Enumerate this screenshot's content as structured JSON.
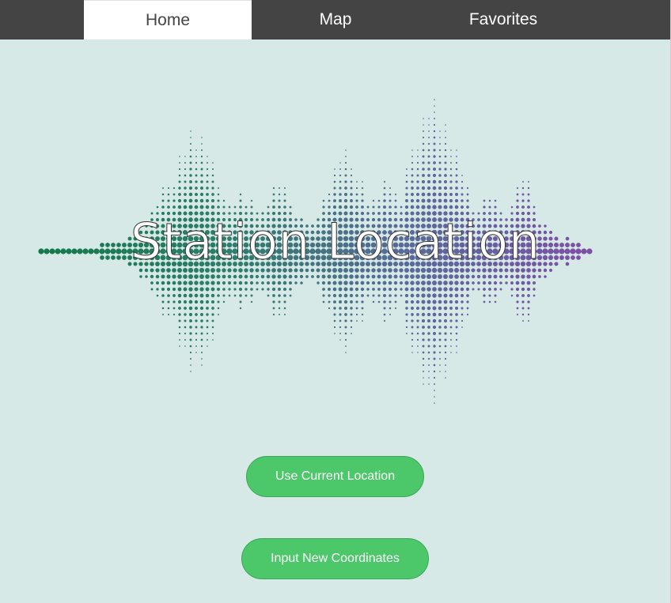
{
  "nav": {
    "tabs": [
      {
        "label": "Home",
        "active": true
      },
      {
        "label": "Map",
        "active": false
      },
      {
        "label": "Favorites",
        "active": false
      }
    ]
  },
  "hero": {
    "title": "Station Location",
    "graphic": "sound-wave-dots",
    "gradient_colors": [
      "#127a4a",
      "#2e7d6a",
      "#5a6a9a",
      "#7e4fa8"
    ]
  },
  "actions": {
    "use_current_location": "Use Current Location",
    "input_new_coordinates": "Input New Coordinates"
  },
  "colors": {
    "nav_bg": "#444444",
    "nav_active_bg": "#ffffff",
    "page_bg": "#d7e9e6",
    "button_bg": "#4cc76a"
  }
}
